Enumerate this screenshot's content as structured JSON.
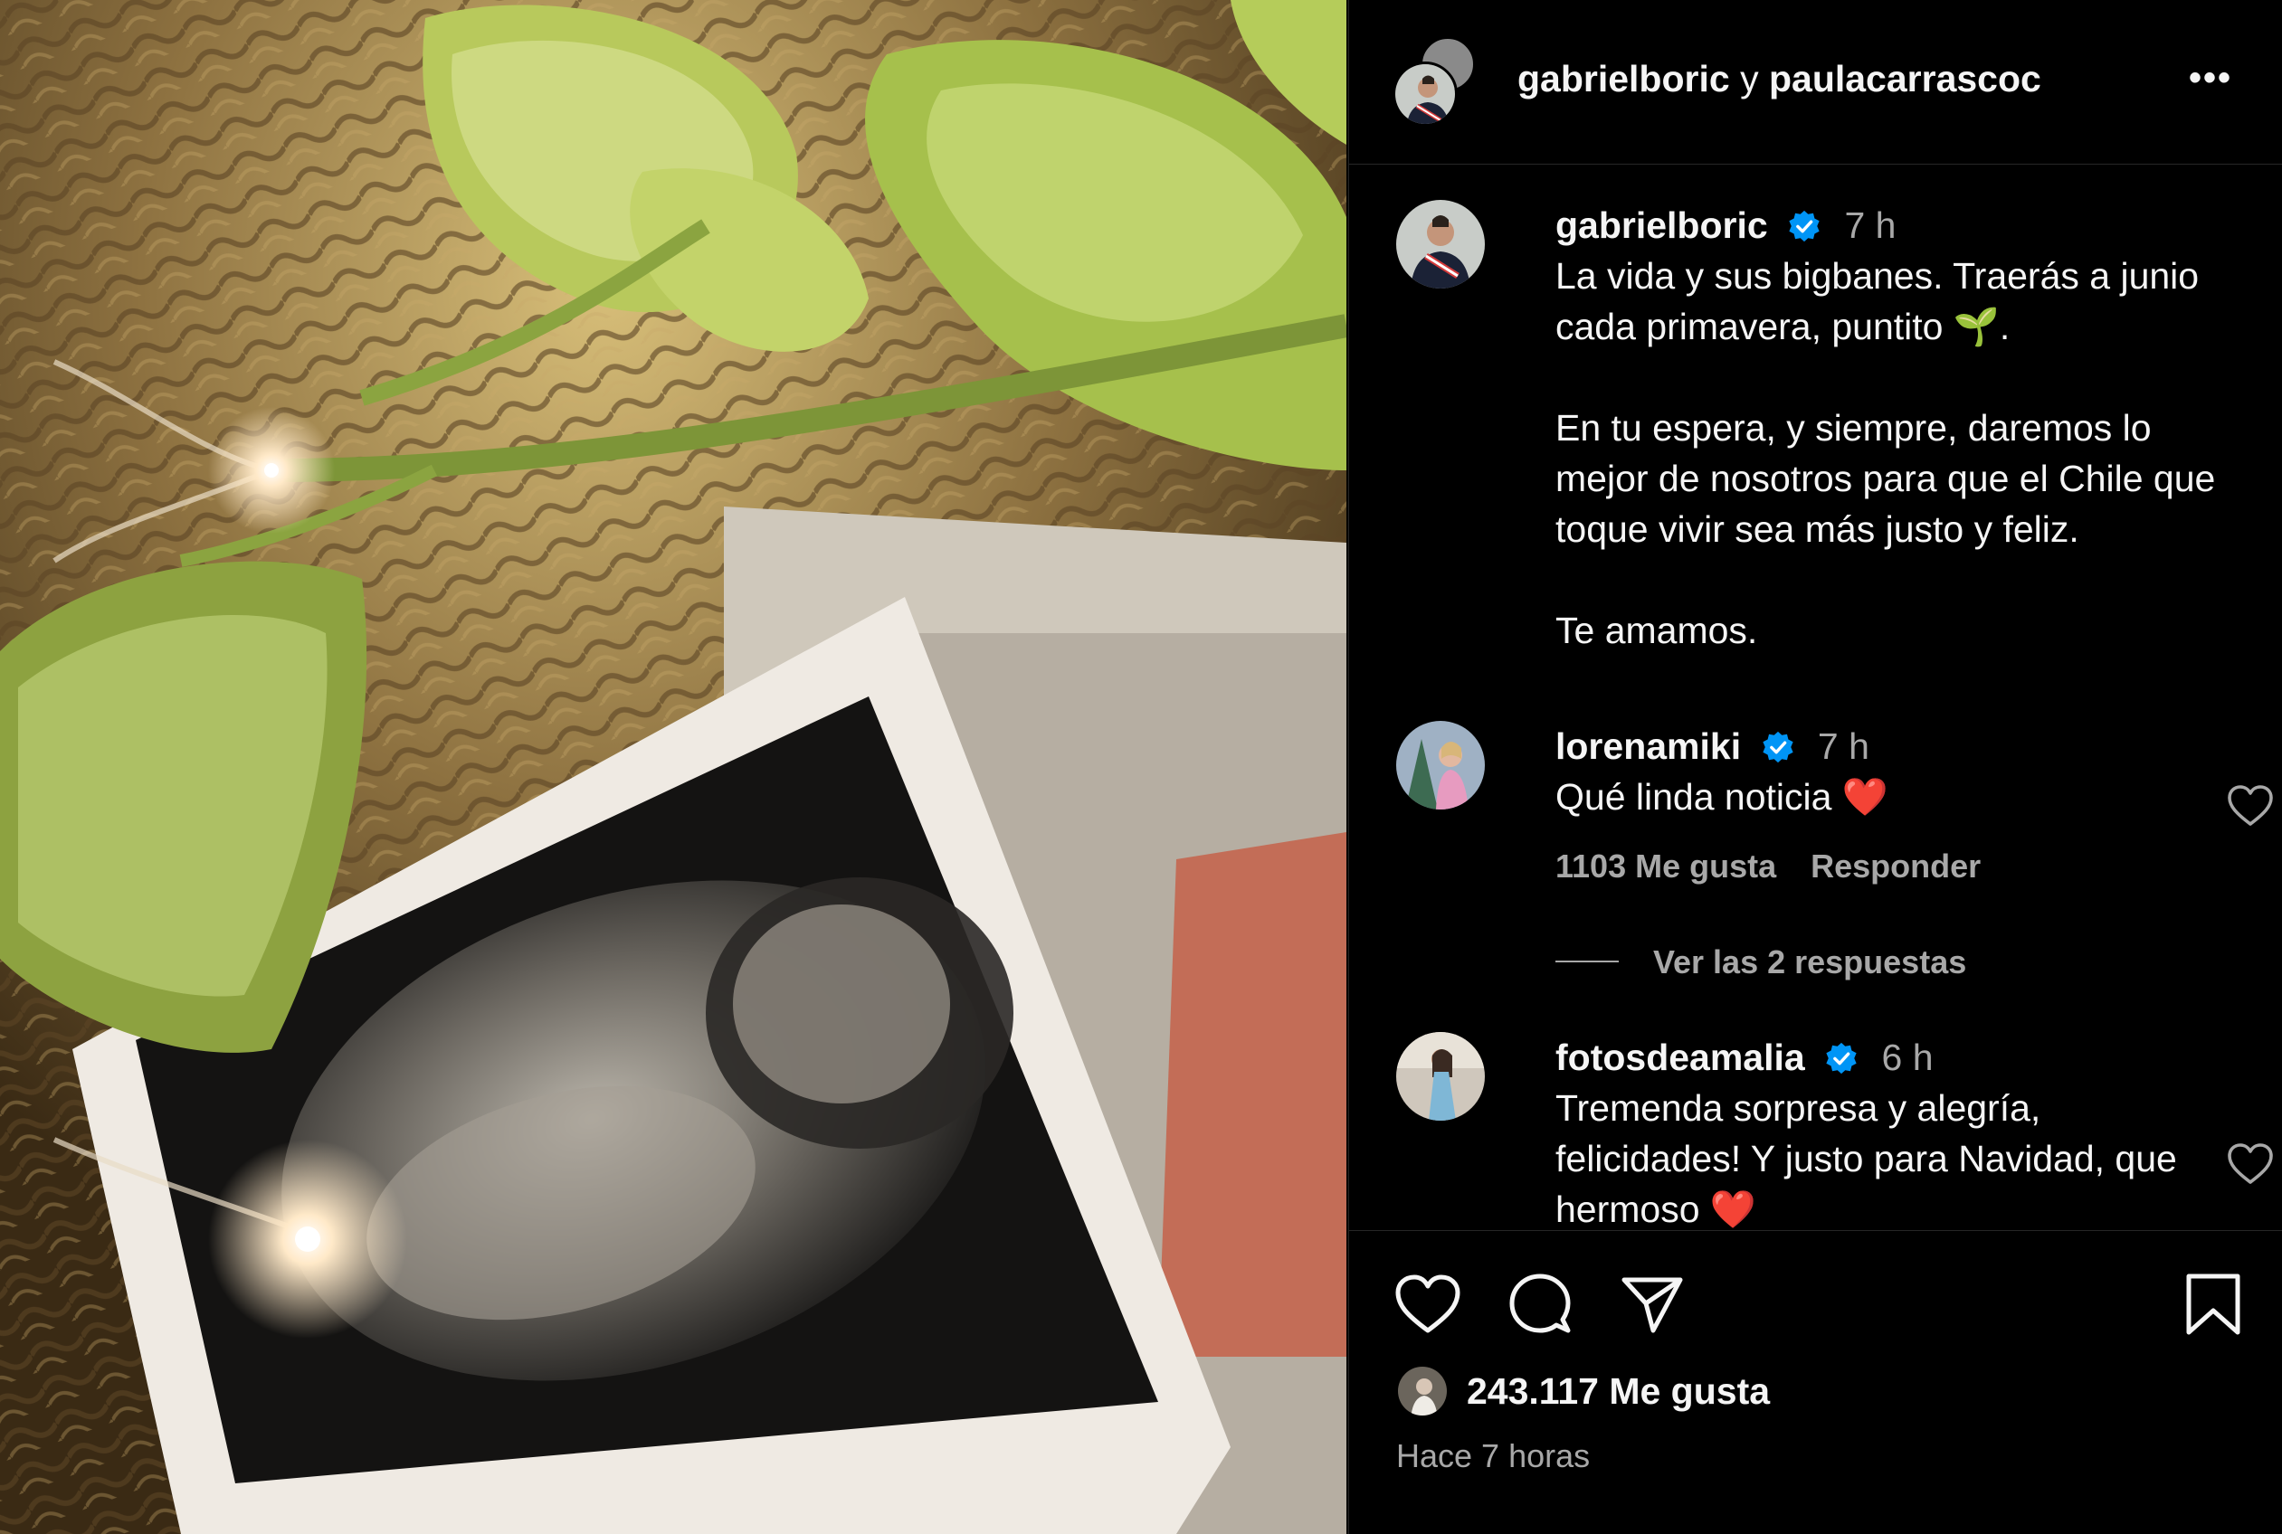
{
  "post": {
    "header": {
      "user1": "gabrielboric",
      "connector": " y ",
      "user2": "paulacarrascoc",
      "more_label": "•••"
    },
    "caption": {
      "username": "gabrielboric",
      "verified": true,
      "time": "7 h",
      "text": "La vida y sus bigbanes. Traerás a junio cada primavera, puntito 🌱.\n\nEn tu espera, y siempre, daremos lo mejor de nosotros para que el Chile que toque vivir sea más justo y feliz.\n\nTe amamos."
    },
    "comments": [
      {
        "username": "lorenamiki",
        "verified": true,
        "time": "7 h",
        "text": "Qué linda noticia ❤️",
        "likes_label": "1103 Me gusta",
        "reply_label": "Responder",
        "view_replies_label": "Ver las 2 respuestas"
      },
      {
        "username": "fotosdeamalia",
        "verified": true,
        "time": "6 h",
        "text": "Tremenda sorpresa y alegría, felicidades! Y justo para Navidad, que hermoso ❤️"
      }
    ],
    "footer": {
      "likes_label": "243.117 Me gusta",
      "posted_ago": "Hace 7 horas"
    }
  },
  "icons": {
    "like": "heart-icon",
    "comment": "comment-bubble-icon",
    "share": "paper-plane-icon",
    "save": "bookmark-icon",
    "verified": "verified-badge-icon"
  },
  "colors": {
    "background": "#000000",
    "text": "#f5f5f5",
    "muted": "#a8a8a8",
    "verified": "#0095f6",
    "divider": "#262626"
  }
}
